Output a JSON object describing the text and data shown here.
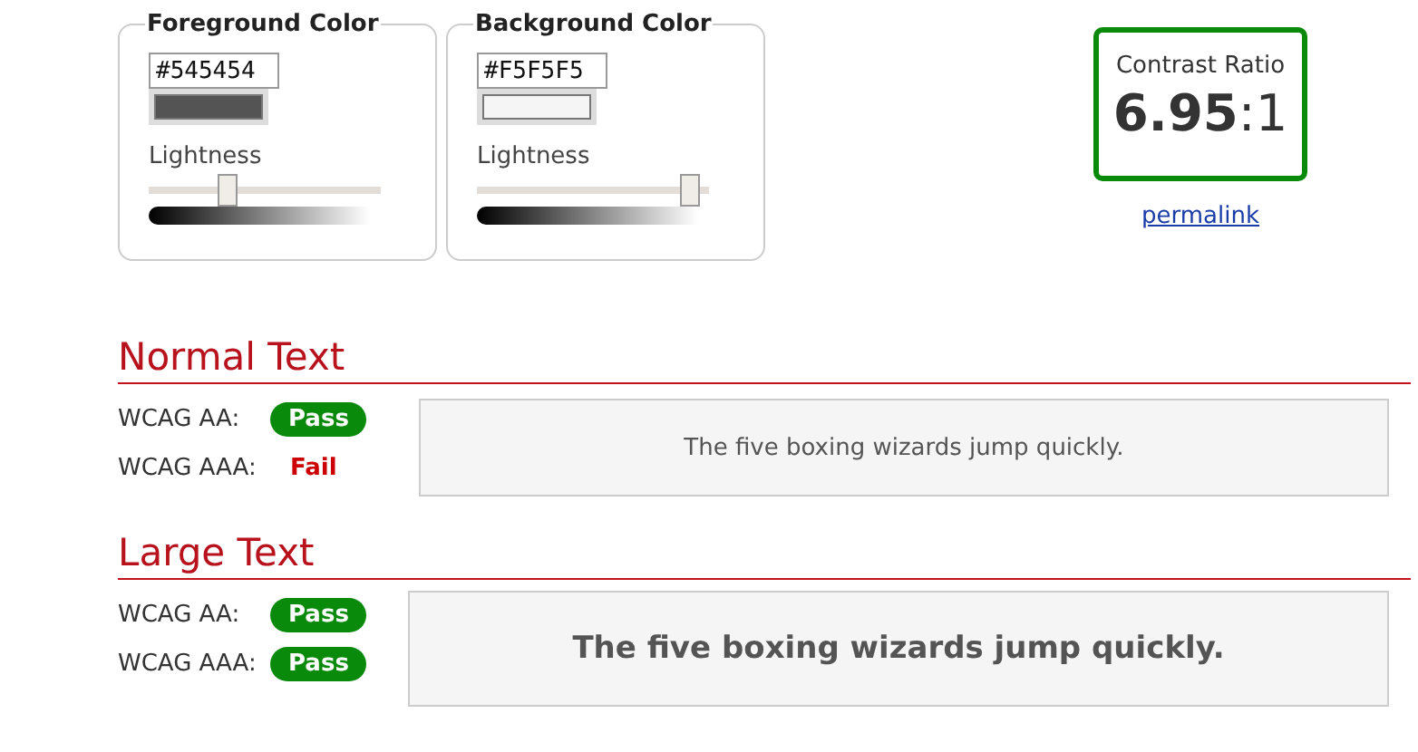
{
  "pickers": [
    {
      "legend": "Foreground Color",
      "value": "#545454",
      "slider_label": "Lightness",
      "level": 0.34
    },
    {
      "legend": "Background Color",
      "value": "#F5F5F5",
      "slider_label": "Lightness",
      "level": 0.92
    }
  ],
  "contrast": {
    "title": "Contrast Ratio",
    "ratio": "6.95",
    "suffix": ":1",
    "pass": true,
    "link": "permalink"
  },
  "sections": [
    {
      "heading": "Normal Text",
      "kind": "normal",
      "sample": "The five boxing wizards jump quickly.",
      "results": [
        {
          "label": "WCAG AA:",
          "status": "Pass",
          "pass": true
        },
        {
          "label": "WCAG AAA:",
          "status": "Fail",
          "pass": false
        }
      ]
    },
    {
      "heading": "Large Text",
      "kind": "large",
      "sample": "The five boxing wizards jump quickly.",
      "results": [
        {
          "label": "WCAG AA:",
          "status": "Pass",
          "pass": true
        },
        {
          "label": "WCAG AAA:",
          "status": "Pass",
          "pass": true
        }
      ]
    }
  ]
}
